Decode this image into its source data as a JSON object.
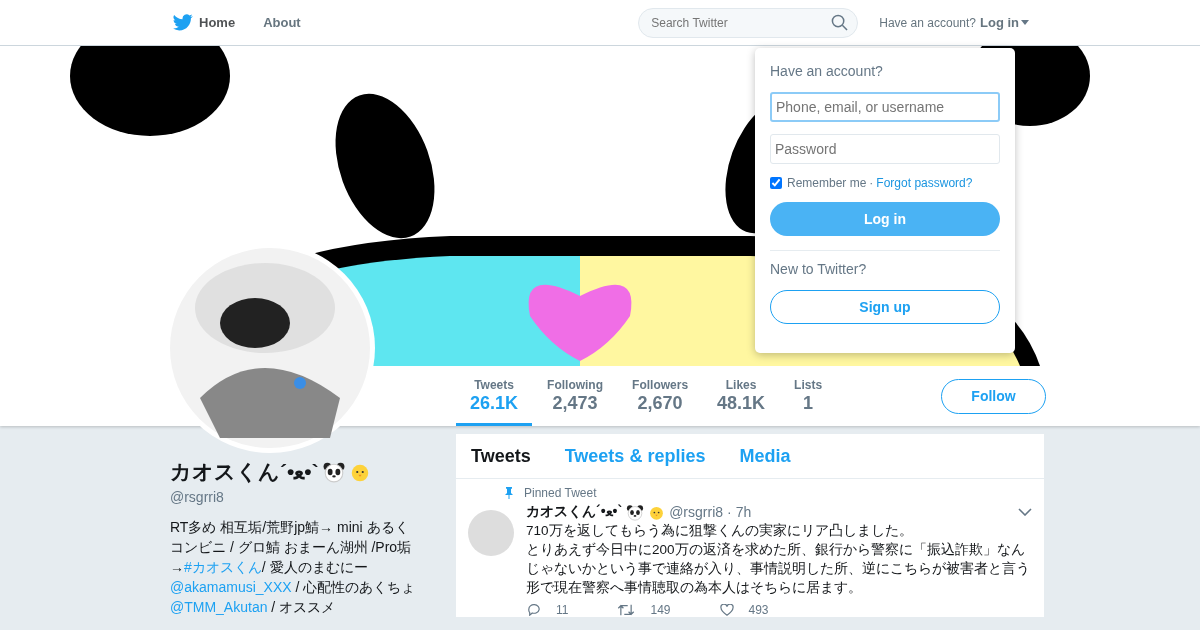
{
  "nav": {
    "items": [
      {
        "label": "Home",
        "selected": true
      },
      {
        "label": "About",
        "selected": false
      }
    ],
    "search": {
      "placeholder": "Search Twitter"
    },
    "account_prompt": "Have an account?",
    "login": "Log in"
  },
  "login_dropdown": {
    "title": "Have an account?",
    "username": {
      "placeholder": "Phone, email, or username"
    },
    "password": {
      "placeholder": "Password"
    },
    "remember": {
      "label": "Remember me",
      "checked": true
    },
    "separator": "·",
    "forgot": "Forgot password?",
    "login_button": "Log in",
    "new_prompt": "New to Twitter?",
    "signup_button": "Sign up"
  },
  "stats": [
    {
      "label": "Tweets",
      "value": "26.1K",
      "selected": true
    },
    {
      "label": "Following",
      "value": "2,473",
      "selected": false
    },
    {
      "label": "Followers",
      "value": "2,670",
      "selected": false
    },
    {
      "label": "Likes",
      "value": "48.1K",
      "selected": false
    },
    {
      "label": "Lists",
      "value": "1",
      "selected": false
    }
  ],
  "follow_button": "Follow",
  "profile": {
    "name": "カオスくん´•ﻌ•`",
    "handle": "@rsgrri8",
    "bio": [
      {
        "kind": "text",
        "text": "RT多め 相互垢/荒野jp鯖→ mini あるくコンビニ / グロ鯖 おまーん湖州 /Pro垢→"
      },
      {
        "kind": "link",
        "text": "#カオスくん"
      },
      {
        "kind": "text",
        "text": "/ 愛人のまむにー "
      },
      {
        "kind": "link",
        "text": "@akamamusi_XXX"
      },
      {
        "kind": "text",
        "text": " / 心配性のあくちょ "
      },
      {
        "kind": "link",
        "text": "@TMM_Akutan"
      },
      {
        "kind": "text",
        "text": " / オススメ"
      }
    ]
  },
  "timeline_tabs": [
    {
      "label": "Tweets",
      "selected": true
    },
    {
      "label": "Tweets & replies",
      "selected": false
    },
    {
      "label": "Media",
      "selected": false
    }
  ],
  "tweet": {
    "pinned_label": "Pinned Tweet",
    "name": "カオスくん´•ﻌ•`",
    "handle": "@rsgrri8",
    "separator": "·",
    "time": "7h",
    "text": [
      "710万を返してもらう為に狙撃くんの実家にリア凸しました。",
      "とりあえず今日中に200万の返済を求めた所、銀行から警察に「振込詐欺」なんじゃないかという事で連絡が入り、事情説明した所、逆にこちらが被害者と言う形で現在警察へ事情聴取の為本人はそちらに居ます。"
    ],
    "actions": [
      {
        "kind": "reply",
        "count": "11"
      },
      {
        "kind": "retweet",
        "count": "149"
      },
      {
        "kind": "like",
        "count": "493"
      }
    ]
  }
}
